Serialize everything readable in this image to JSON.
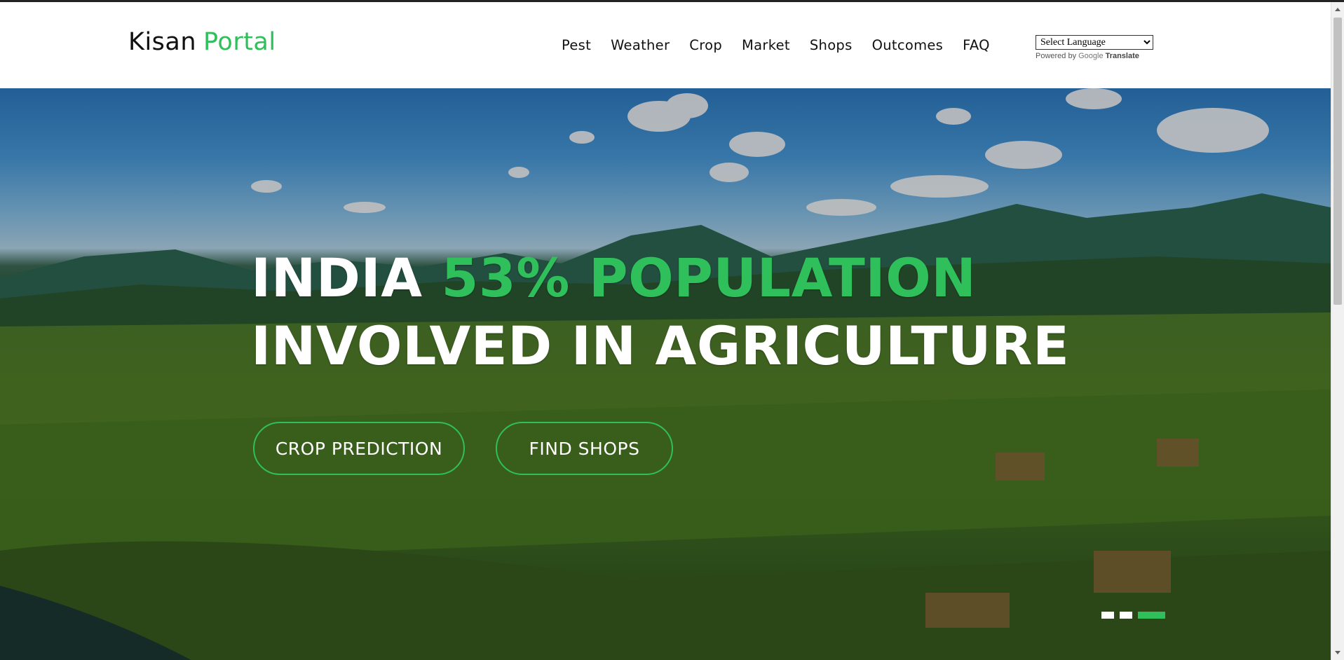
{
  "brand": {
    "name": "Kisan",
    "accent": "Portal",
    "accent_color": "#2fbf5b"
  },
  "nav": {
    "items": [
      {
        "label": "Pest"
      },
      {
        "label": "Weather"
      },
      {
        "label": "Crop"
      },
      {
        "label": "Market"
      },
      {
        "label": "Shops"
      },
      {
        "label": "Outcomes"
      },
      {
        "label": "FAQ"
      }
    ]
  },
  "translate": {
    "selected": "Select Language",
    "powered_by": "Powered by",
    "google": "Google",
    "translate": "Translate"
  },
  "hero": {
    "line1_white": "INDIA",
    "line1_green": "53% POPULATION",
    "line2": "INVOLVED IN AGRICULTURE",
    "buttons": {
      "crop_prediction": "CROP PREDICTION",
      "find_shops": "FIND SHOPS"
    },
    "slides": {
      "count": 3,
      "active_index": 2
    }
  }
}
